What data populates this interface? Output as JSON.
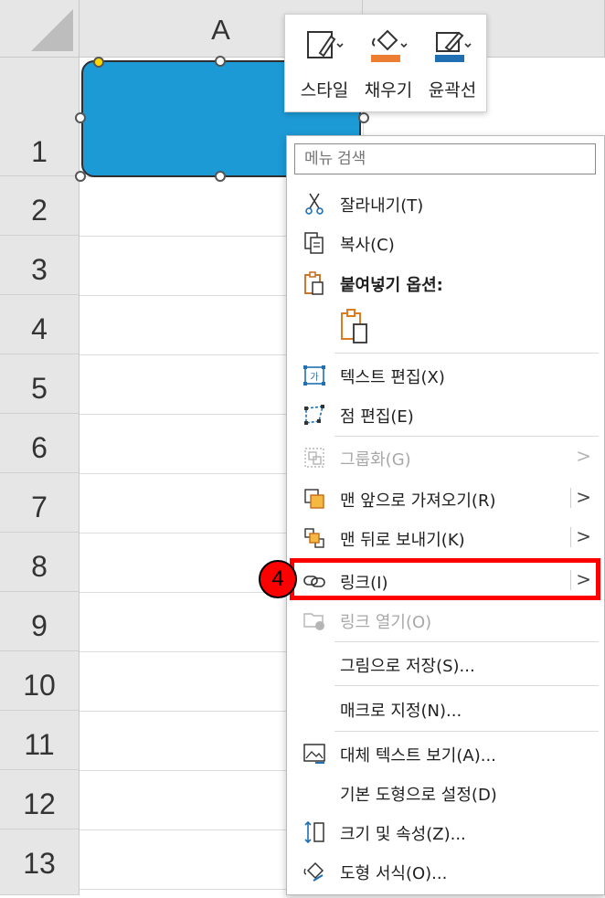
{
  "spreadsheet": {
    "column_header": "A",
    "row_numbers": [
      "1",
      "2",
      "3",
      "4",
      "5",
      "6",
      "7",
      "8",
      "9",
      "10",
      "11",
      "12",
      "13"
    ]
  },
  "mini_toolbar": {
    "style_label": "스타일",
    "fill_label": "채우기",
    "outline_label": "윤곽선",
    "fill_color": "#ed7d31",
    "outline_color": "#1f6fb2"
  },
  "context_menu": {
    "search_placeholder": "메뉴 검색",
    "items": {
      "cut": "잘라내기(T)",
      "copy": "복사(C)",
      "paste_options": "붙여넣기 옵션:",
      "edit_text": "텍스트 편집(X)",
      "edit_points": "점 편집(E)",
      "group": "그룹화(G)",
      "bring_to_front": "맨 앞으로 가져오기(R)",
      "send_to_back": "맨 뒤로 보내기(K)",
      "link": "링크(I)",
      "open_link": "링크 열기(O)",
      "save_as_picture": "그림으로 저장(S)...",
      "assign_macro": "매크로 지정(N)...",
      "alt_text": "대체 텍스트 보기(A)...",
      "set_default_shape": "기본 도형으로 설정(D)",
      "size_properties": "크기 및 속성(Z)...",
      "format_shape": "도형 서식(O)..."
    },
    "submenu_arrow": ">"
  },
  "annotation": {
    "step_number": "4",
    "highlight_color": "#ff0000"
  },
  "colors": {
    "shape_fill": "#1c9ad6",
    "header_bg": "#e6e6e6"
  }
}
